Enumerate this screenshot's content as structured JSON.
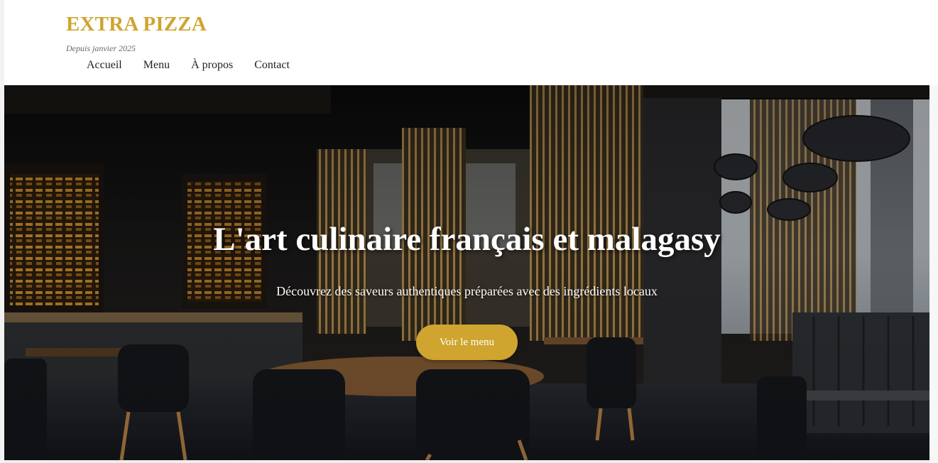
{
  "header": {
    "logo": "EXTRA PIZZA",
    "tagline": "Depuis janvier 2025",
    "nav": [
      {
        "label": "Accueil"
      },
      {
        "label": "Menu"
      },
      {
        "label": "À propos"
      },
      {
        "label": "Contact"
      }
    ]
  },
  "hero": {
    "title": "L'art culinaire français et malagasy",
    "subtitle": "Découvrez des saveurs authentiques préparées avec des ingrédients locaux",
    "cta_label": "Voir le menu",
    "background_icon": "restaurant-interior-photo"
  },
  "colors": {
    "accent": "#cfa52f",
    "text_dark": "#222222",
    "hero_text": "#ffffff"
  }
}
